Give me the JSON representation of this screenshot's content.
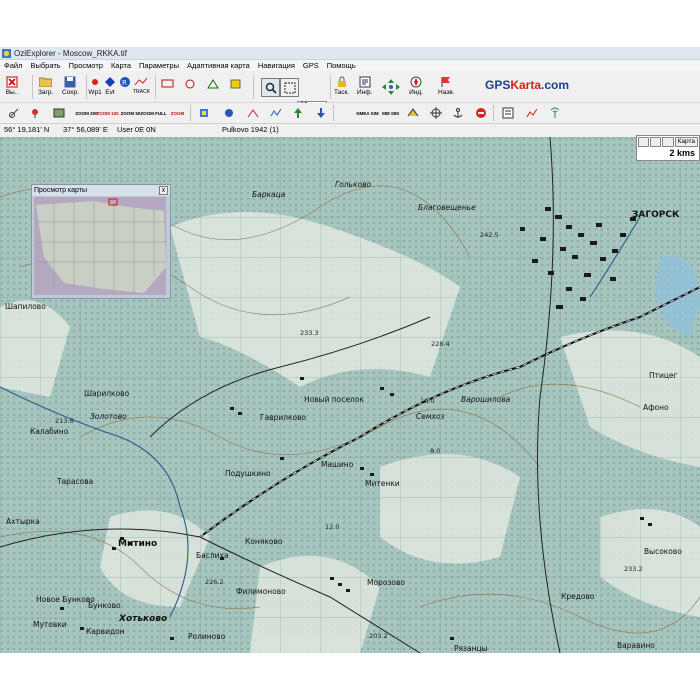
{
  "window": {
    "title": "OziExplorer - Moscow_RKKA.tif"
  },
  "menu": [
    "Файл",
    "Выбрать",
    "Просмотр",
    "Карта",
    "Параметры",
    "Адаптивная карта",
    "Навигация",
    "GPS",
    "Помощь"
  ],
  "toolbar1": {
    "exit_label": "Вы..",
    "load_label": "Загр.",
    "save_label": "Сохр.",
    "wp_label": "Wp1",
    "evt_label": "Evt",
    "track_label": "TRACK",
    "zoom_value": "80",
    "task_label": "Таск.",
    "info_label": "Инф.",
    "ind_label": "Инд.",
    "nav_label": "Назв."
  },
  "toolbar2": {
    "zoom_labels": [
      "ZOOM 200",
      "ZOOM 100",
      "ZOOM 50",
      "ZOOM FULL",
      "ZOOM"
    ],
    "misc_labels": [
      "NMEA SIM",
      "MM SIM"
    ]
  },
  "brand": {
    "part1": "GPS",
    "part2": "Karta",
    "part3": ".com"
  },
  "coords": {
    "lat": "56° 19,181' N",
    "lon": "37° 56,089' E",
    "user": "User 0E 0N",
    "datum": "Pulkovo 1942 (1)"
  },
  "scale": {
    "map_button": "Карта",
    "distance": "2 kms"
  },
  "overview": {
    "title": "Просмотр карты",
    "close": "x"
  },
  "map_labels": [
    "Баркаца",
    "Гольково",
    "Благовещенье",
    "ЗАГОРСК",
    "Шапилово",
    "Новый поселок",
    "Варошилова",
    "Птицег",
    "Гаврилково",
    "Подушкино",
    "Машино",
    "Митенки",
    "Афоно",
    "Коняково",
    "Ахтырка",
    "Митино",
    "Тарасова",
    "Высоково",
    "Мутовки",
    "Бунково",
    "Хотьково",
    "Филимоново",
    "Морозово",
    "Кредово",
    "Ролиново",
    "Рязанцы",
    "Варавино",
    "Калабино",
    "Новое Бунково",
    "Карвидон",
    "Шарилково",
    "Баслиха",
    "Семхоз",
    "Золотово"
  ],
  "map_numbers": [
    "242.5",
    "233.3",
    "228.4",
    "213.6",
    "10.0",
    "12.0",
    "226.2",
    "233.2",
    "203.2",
    "8.0"
  ]
}
